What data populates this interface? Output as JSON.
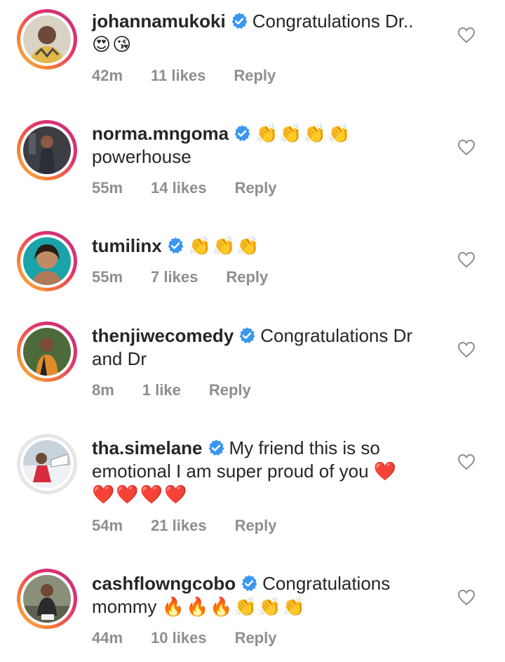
{
  "colors": {
    "verified_badge": "#3897f0",
    "meta_text": "#8e8e8e",
    "text": "#262626"
  },
  "icons": {
    "verified": "verified-badge-icon",
    "like": "heart-outline-icon"
  },
  "comments": [
    {
      "username": "johannamukoki",
      "text": "Congratulations Dr..",
      "emoji": "😍😘",
      "time": "42m",
      "likes": "11 likes",
      "reply": "Reply"
    },
    {
      "username": "norma.mngoma",
      "text": "",
      "emoji": "👏👏👏👏",
      "text2": "powerhouse",
      "time": "55m",
      "likes": "14 likes",
      "reply": "Reply"
    },
    {
      "username": "tumilinx",
      "text": "",
      "emoji": "👏👏👏",
      "time": "55m",
      "likes": "7 likes",
      "reply": "Reply"
    },
    {
      "username": "thenjiwecomedy",
      "text": "Congratulations Dr and Dr",
      "time": "8m",
      "likes": "1 like",
      "reply": "Reply"
    },
    {
      "username": "tha.simelane",
      "text": "My friend this is so emotional I am super proud of you",
      "emoji": "❤️",
      "emoji2": "❤️❤️❤️❤️",
      "time": "54m",
      "likes": "21 likes",
      "reply": "Reply"
    },
    {
      "username": "cashflowngcobo",
      "text": "Congratulations mommy",
      "emoji": "🔥🔥🔥👏👏👏",
      "time": "44m",
      "likes": "10 likes",
      "reply": "Reply"
    }
  ]
}
